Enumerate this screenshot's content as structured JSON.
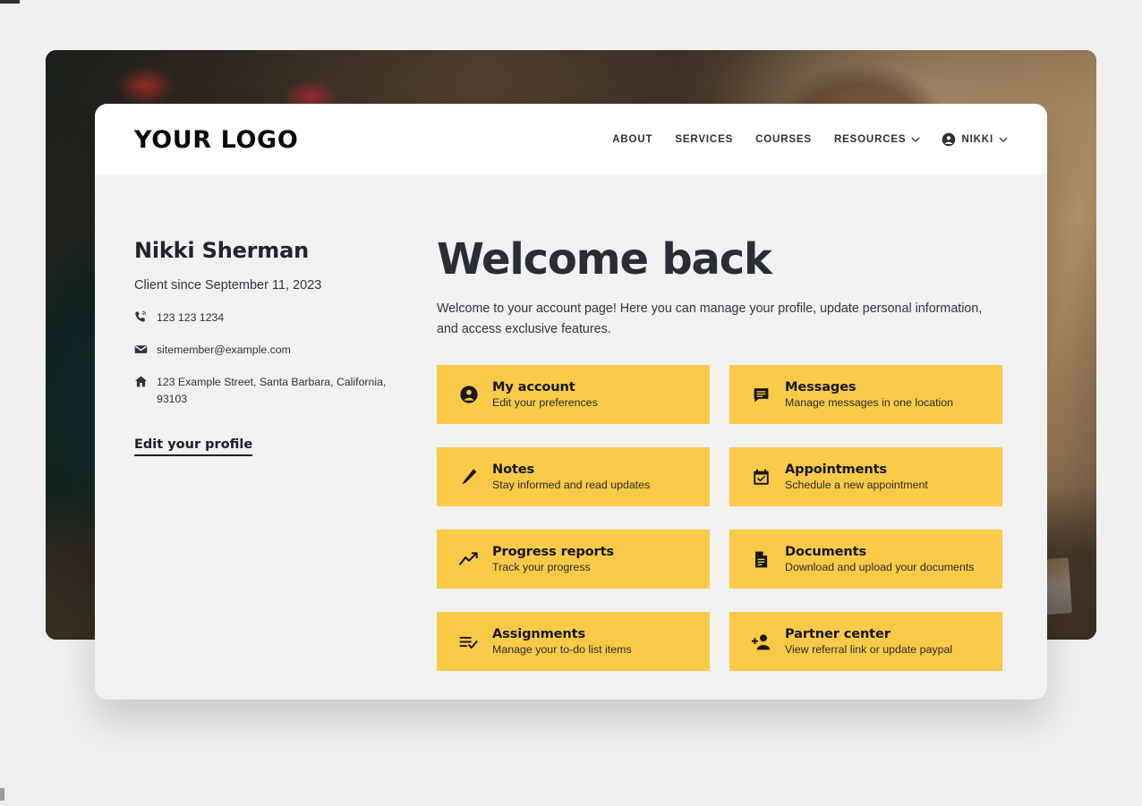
{
  "brand": {
    "logo_text": "YOUR LOGO",
    "accent_color": "#f8ca47",
    "text_color": "#2b2d35",
    "card_bg": "#f1f1f1",
    "page_bg": "#efefef"
  },
  "nav": {
    "links": [
      {
        "label": "ABOUT",
        "icon": "",
        "has_chevron": false
      },
      {
        "label": "SERVICES",
        "icon": "",
        "has_chevron": false
      },
      {
        "label": "COURSES",
        "icon": "",
        "has_chevron": false
      },
      {
        "label": "RESOURCES",
        "icon": "chevron-down-icon",
        "has_chevron": true
      }
    ],
    "user": {
      "label": "NIKKI",
      "icon": "account-circle-icon",
      "chevron": "chevron-down-icon"
    }
  },
  "sidebar": {
    "name": "Nikki Sherman",
    "client_since": "Client since September 11, 2023",
    "contacts": [
      {
        "icon": "phone-icon",
        "value": "123 123 1234"
      },
      {
        "icon": "envelope-icon",
        "value": "sitemember@example.com"
      },
      {
        "icon": "home-icon",
        "value": "123 Example Street, Santa Barbara, California, 93103"
      }
    ],
    "edit_profile_label": "Edit your profile"
  },
  "main": {
    "heading": "Welcome back",
    "intro": "Welcome to your account page! Here you can manage your profile, update personal information, and access exclusive features.",
    "tiles": [
      {
        "title": "My account",
        "subtitle": "Edit your preferences",
        "icon": "account-circle-icon"
      },
      {
        "title": "Messages",
        "subtitle": "Manage messages in one location",
        "icon": "chat-bubble-icon"
      },
      {
        "title": "Notes",
        "subtitle": "Stay informed and read updates",
        "icon": "pencil-icon"
      },
      {
        "title": "Appointments",
        "subtitle": "Schedule a new appointment",
        "icon": "calendar-check-icon"
      },
      {
        "title": "Progress reports",
        "subtitle": "Track your progress",
        "icon": "line-chart-icon"
      },
      {
        "title": "Documents",
        "subtitle": "Download and upload your documents",
        "icon": "document-icon"
      },
      {
        "title": "Assignments",
        "subtitle": "Manage your to-do list items",
        "icon": "task-list-check-icon"
      },
      {
        "title": "Partner center",
        "subtitle": "View referral link or update paypal",
        "icon": "add-person-icon"
      }
    ]
  }
}
